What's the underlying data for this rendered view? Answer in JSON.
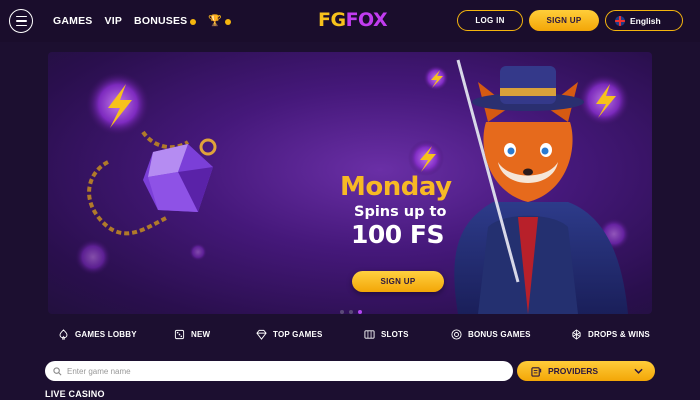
{
  "header": {
    "nav": [
      {
        "label": "GAMES"
      },
      {
        "label": "VIP"
      },
      {
        "label": "BONUSES"
      }
    ],
    "logo": {
      "part1": "FG",
      "part2": "FOX"
    },
    "login_label": "LOG IN",
    "signup_label": "SIGN UP",
    "language": "English"
  },
  "banner": {
    "title": "Monday",
    "subtitle": "Spins up to",
    "amount": "100 FS",
    "cta_label": "SIGN UP",
    "slides_total": 3,
    "active_slide": 3
  },
  "categories": [
    {
      "label": "GAMES LOBBY",
      "icon": "spade-icon"
    },
    {
      "label": "NEW",
      "icon": "dice-icon"
    },
    {
      "label": "TOP GAMES",
      "icon": "diamond-icon"
    },
    {
      "label": "SLOTS",
      "icon": "slots-icon"
    },
    {
      "label": "BONUS GAMES",
      "icon": "chip-icon"
    },
    {
      "label": "DROPS & WINS",
      "icon": "gem-icon"
    }
  ],
  "search": {
    "placeholder": "Enter game name"
  },
  "providers": {
    "label": "PROVIDERS"
  },
  "section": {
    "title": "LIVE CASINO"
  },
  "colors": {
    "accent": "#f5b50e",
    "background": "#1c0f30",
    "logo_purple": "#c13cf0",
    "pager_active": "#b447f0"
  }
}
